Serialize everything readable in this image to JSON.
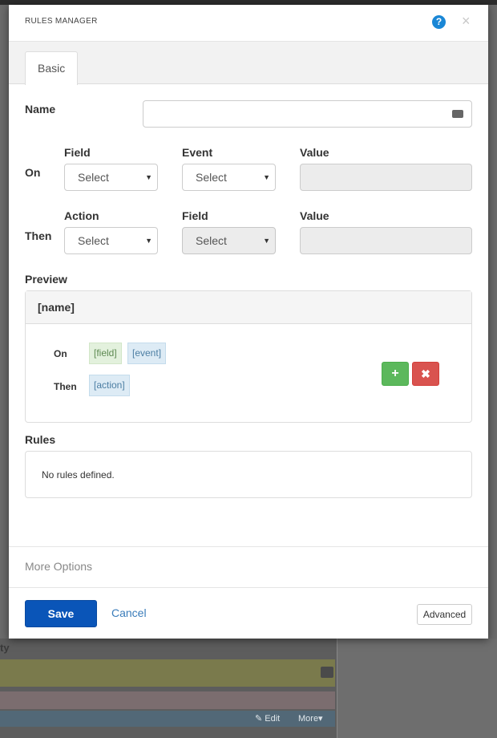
{
  "modal": {
    "title": "RULES MANAGER",
    "help_icon": "question-icon",
    "close_icon": "close-icon",
    "close_glyph": "×"
  },
  "tabs": [
    {
      "label": "Basic",
      "active": true
    }
  ],
  "form": {
    "name_label": "Name",
    "name_value": "",
    "on_label": "On",
    "then_label": "Then",
    "on_row": {
      "field_label": "Field",
      "field_value": "Select",
      "event_label": "Event",
      "event_value": "Select",
      "value_label": "Value",
      "value_value": ""
    },
    "then_row": {
      "action_label": "Action",
      "action_value": "Select",
      "field_label": "Field",
      "field_value": "Select",
      "value_label": "Value",
      "value_value": ""
    }
  },
  "preview": {
    "section_label": "Preview",
    "header": "[name]",
    "on_label": "On",
    "then_label": "Then",
    "on_tags": [
      "[field]",
      "[event]"
    ],
    "then_tags": [
      "[action]"
    ],
    "add_glyph": "+",
    "remove_glyph": "✖"
  },
  "rules": {
    "section_label": "Rules",
    "empty_text": "No rules defined."
  },
  "footer": {
    "more_options": "More Options",
    "save": "Save",
    "cancel": "Cancel",
    "advanced": "Advanced"
  },
  "background": {
    "label_ty": "ty",
    "edit": "✎ Edit",
    "more": "More▾"
  },
  "colors": {
    "primary": "#0a55b8",
    "success": "#5cb85c",
    "danger": "#d9534f",
    "help": "#1a87d6"
  }
}
